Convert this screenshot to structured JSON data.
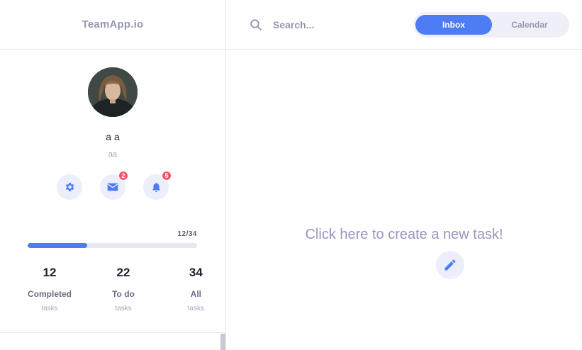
{
  "brand": {
    "name": "TeamApp.io"
  },
  "profile": {
    "name": "a a",
    "handle": "aa",
    "avatar_alt": "user avatar"
  },
  "actions": {
    "settings_icon": "gear-icon",
    "messages_icon": "envelope-icon",
    "messages_count": "2",
    "notifications_icon": "bell-icon",
    "notifications_count": "5"
  },
  "progress": {
    "label": "12/34",
    "completed": 12,
    "total": 34
  },
  "stats": [
    {
      "value": "12",
      "label": "Completed",
      "sub": "tasks"
    },
    {
      "value": "22",
      "label": "To do",
      "sub": "tasks"
    },
    {
      "value": "34",
      "label": "All",
      "sub": "tasks"
    }
  ],
  "search": {
    "placeholder": "Search...",
    "value": ""
  },
  "tabs": [
    {
      "label": "Inbox",
      "active": true
    },
    {
      "label": "Calendar",
      "active": false
    }
  ],
  "empty_state": {
    "cta": "Click here to create a new task!",
    "icon": "pencil-icon"
  },
  "colors": {
    "accent": "#4e7cf5",
    "badge": "#f2556d",
    "muted": "#9597b2"
  }
}
